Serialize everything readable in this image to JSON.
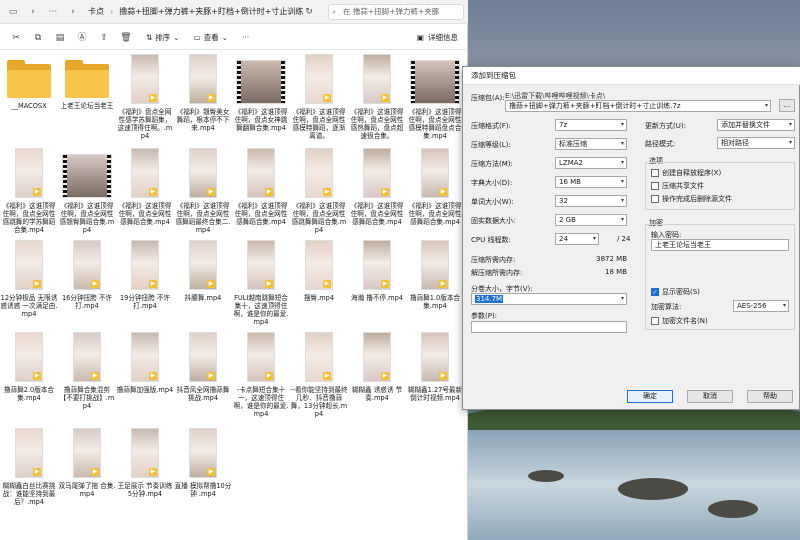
{
  "explorer": {
    "breadcrumb": [
      "卡点",
      "撸蒜+扭脚+弹力裤+夹豚+盯档+倒计时+寸止训练"
    ],
    "search_placeholder": "在 撸蒜+扭脚+弹力裤+夹豚",
    "toolbar": {
      "sort_label": "排序",
      "view_label": "查看",
      "more_label": "···",
      "details_label": "详细信息"
    },
    "items": [
      {
        "name": "__MACOSX",
        "kind": "folder"
      },
      {
        "name": "上老王论坛当老王",
        "kind": "folder"
      },
      {
        "name": "《福利》盘点全网性感学苏舞蹈集，这速顶得住啊。.mp4",
        "kind": "video"
      },
      {
        "name": "《福利》翘臀美女舞蹈，根本停不下来.mp4",
        "kind": "video"
      },
      {
        "name": "《福利》这谁顶得住啊，盘点女神跳舞翻舞合集.mp4",
        "kind": "film"
      },
      {
        "name": "《福利》这谁顶得住啊，盘点全网性感模特舞蹈，逐渐离谱。",
        "kind": "video"
      },
      {
        "name": "《福利》这谁顶得住啊，盘点全网性感热舞蹈，盘点超速很合集。",
        "kind": "video"
      },
      {
        "name": "《福利》这谁顶得住啊，盘点全网性感模特舞蹈盘点合集.mp4",
        "kind": "film"
      },
      {
        "name": "《福利》这谁顶得住啊，盘点全网性感跳舞的学苏舞蹈合集.mp4",
        "kind": "video"
      },
      {
        "name": "《福利》这谁顶得住啊，盘点全网性感翘臀舞蹈合集.mp4",
        "kind": "film"
      },
      {
        "name": "《福利》这谁顶得住啊，盘点全网性感舞蹈合集.mp4",
        "kind": "video"
      },
      {
        "name": "《福利》这谁顶得住啊，盘点全网性感舞蹈最终合集二.mp4",
        "kind": "video"
      },
      {
        "name": "《福利》这谁顶得住啊，盘点全网性感舞蹈合集.mp4",
        "kind": "video"
      },
      {
        "name": "《福利》这谁顶得住啊，盘点全网性感跳舞舞蹈合集.mp4",
        "kind": "video"
      },
      {
        "name": "《福利》这谁顶得住啊，盘点全网性感舞蹈合集.mp4",
        "kind": "video"
      },
      {
        "name": "《福利》这谁顶得住啊，盘点全网性感舞蹈合集.mp4",
        "kind": "video"
      },
      {
        "name": "12分钟极品 无限诱惑诱惑 一次满足由.mp4",
        "kind": "video"
      },
      {
        "name": "16分钟扭胯 不许打.mp4",
        "kind": "video"
      },
      {
        "name": "19分钟扭胯 不许打.mp4",
        "kind": "video"
      },
      {
        "name": "抖腰舞.mp4",
        "kind": "video"
      },
      {
        "name": "FULI越南跳舞短合集十，这速顶得住啊，谁是你的最爱.mp4",
        "kind": "video"
      },
      {
        "name": "摆臀.mp4",
        "kind": "video"
      },
      {
        "name": "海瀚 撸不停.mp4",
        "kind": "video"
      },
      {
        "name": "撸蒜舞1.0版本合集.mp4",
        "kind": "video"
      },
      {
        "name": "撸蒜舞2.0版本合集.mp4",
        "kind": "video"
      },
      {
        "name": "撸蒜舞合集混剪【不要打挑战】.mp4",
        "kind": "video"
      },
      {
        "name": "撸蒜舞加强版.mp4",
        "kind": "video"
      },
      {
        "name": "抖音风全网撸蒜舞挑战.mp4",
        "kind": "video"
      },
      {
        "name": "-卡点舞短合集十一，这速顶得住啊，谁是你的最爱.mp4",
        "kind": "video"
      },
      {
        "name": "--看你能坚持到最终几秒、抖音撸蒜舞，13分钟超长.mp4",
        "kind": "video"
      },
      {
        "name": "糊糊鑫 诱惑诱 节奏.mp4",
        "kind": "video"
      },
      {
        "name": "糊糊鑫1.27号最新倒计时视频.mp4",
        "kind": "video"
      },
      {
        "name": "糊糊鑫白丝比赛挑战：谁能坚持到最后？.mp4",
        "kind": "video"
      },
      {
        "name": "双马尾弹了拖 合集.mp4",
        "kind": "video"
      },
      {
        "name": "王足展示 节奏训练 5分钟.mp4",
        "kind": "video"
      },
      {
        "name": "直播 模拟帮撸10分钟 .mp4",
        "kind": "video"
      }
    ]
  },
  "dialog": {
    "title": "添加到压缩包",
    "archive_label": "压缩包(A):",
    "archive_path": "E:\\迅雷下载\\哔哩哔哩视频\\卡点\\",
    "archive_name": "撸蒜+扭脚+弹力裤+夹豚+盯档+倒计时+寸止训练.7z",
    "browse_label": "...",
    "format_label": "压缩格式(F):",
    "format_value": "7z",
    "level_label": "压缩等级(L):",
    "level_value": "标准压缩",
    "method_label": "压缩方法(M):",
    "method_value": "LZMA2",
    "dict_label": "字典大小(D):",
    "dict_value": "16 MB",
    "word_label": "单词大小(W):",
    "word_value": "32",
    "solid_label": "固实数据大小:",
    "solid_value": "2 GB",
    "cpu_label": "CPU 线程数:",
    "cpu_value": "24",
    "cpu_total": "/ 24",
    "mem_compress_label": "压缩所需内存:",
    "mem_compress_value": "3872 MB",
    "mem_decompress_label": "解压缩所需内存:",
    "mem_decompress_value": "18 MB",
    "split_label": "分卷大小，字节(V):",
    "split_value": "314.7M",
    "params_label": "参数(P):",
    "update_label": "更新方式(U):",
    "update_value": "添加并替换文件",
    "path_label": "路径模式:",
    "path_value": "相对路径",
    "options_title": "选项",
    "opt_sfx": "创建自释放程序(X)",
    "opt_shared": "压缩共享文件",
    "opt_delete": "操作完成后删除源文件",
    "encrypt_title": "加密",
    "password_label": "输入密码:",
    "password_value": "上老王论坛当老王",
    "show_password": "显示密码(S)",
    "enc_method_label": "加密算法:",
    "enc_method_value": "AES-256",
    "encrypt_names": "加密文件名(N)",
    "ok_label": "确定",
    "cancel_label": "取消",
    "help_label": "帮助"
  },
  "colors": {
    "accent": "#1d6fd6",
    "folder": "#f7c64b",
    "badge": "#f2c230"
  }
}
